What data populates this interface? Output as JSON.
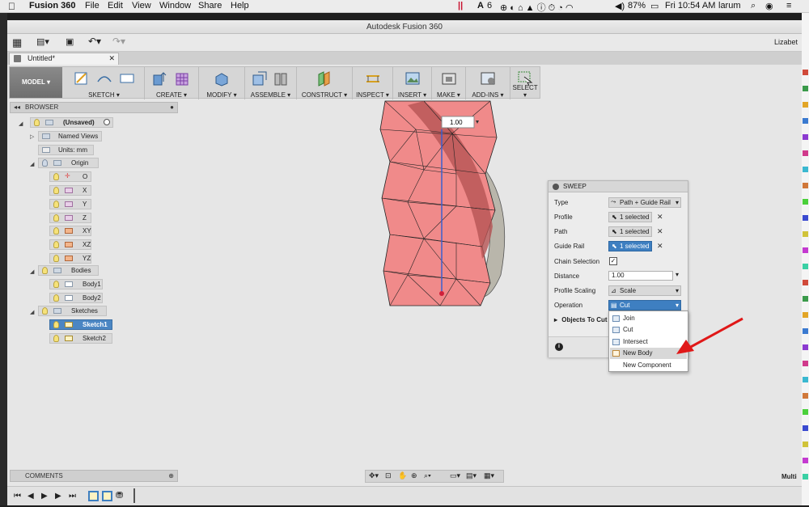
{
  "menubar": {
    "apple": "",
    "app_name": "Fusion 360",
    "items": [
      "File",
      "Edit",
      "View",
      "Window",
      "Share",
      "Help"
    ],
    "adobe_count": "6",
    "battery": "87%",
    "clock": "Fri 10:54 AM",
    "user": "larum"
  },
  "window": {
    "title": "Autodesk Fusion 360",
    "user_short": "Lizabet",
    "doc_tab": "Untitled*",
    "right_label": "Multi"
  },
  "ribbon": {
    "workspace": "MODEL",
    "groups": [
      "SKETCH",
      "CREATE",
      "MODIFY",
      "ASSEMBLE",
      "CONSTRUCT",
      "INSPECT",
      "INSERT",
      "MAKE",
      "ADD-INS",
      "SELECT"
    ]
  },
  "browser": {
    "title": "BROWSER",
    "root": "(Unsaved)",
    "named_views": "Named Views",
    "units": "Units: mm",
    "origin": "Origin",
    "origin_items": [
      "O",
      "X",
      "Y",
      "Z",
      "XY",
      "XZ",
      "YZ"
    ],
    "bodies": "Bodies",
    "body_items": [
      "Body1",
      "Body2"
    ],
    "sketches": "Sketches",
    "sketch_items": [
      "Sketch1",
      "Sketch2"
    ]
  },
  "comments": {
    "title": "COMMENTS"
  },
  "viewport": {
    "manipulator_value": "1.00"
  },
  "sweep": {
    "title": "SWEEP",
    "type_label": "Type",
    "type_value": "Path + Guide Rail",
    "profile_label": "Profile",
    "profile_value": "1 selected",
    "path_label": "Path",
    "path_value": "1 selected",
    "guide_label": "Guide Rail",
    "guide_value": "1 selected",
    "chain_label": "Chain Selection",
    "distance_label": "Distance",
    "distance_value": "1.00",
    "scaling_label": "Profile Scaling",
    "scaling_value": "Scale",
    "operation_label": "Operation",
    "operation_value": "Cut",
    "objects_label": "Objects To Cut",
    "clear": "✕"
  },
  "operation_menu": {
    "options": [
      "Join",
      "Cut",
      "Intersect",
      "New Body",
      "New Component"
    ],
    "highlighted": "New Body"
  },
  "colors": {
    "accent": "#3e7fc1",
    "body_fill": "#f08a8a",
    "arrow": "#e01818"
  }
}
